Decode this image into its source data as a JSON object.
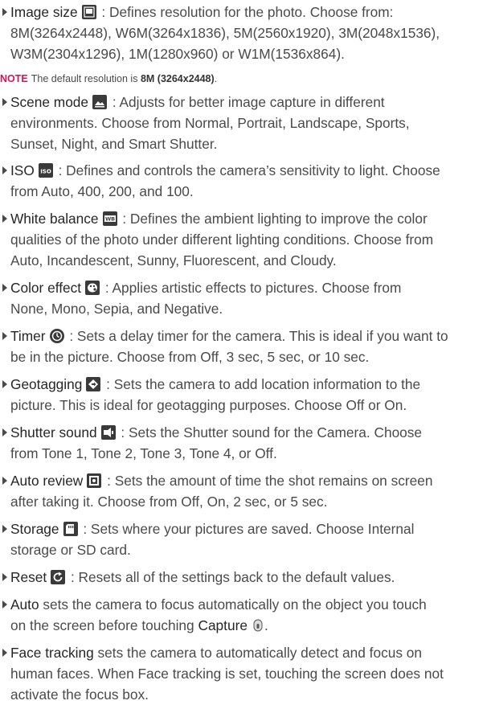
{
  "items": [
    {
      "term": "Image size",
      "icon": "image-size-icon",
      "lines": [
        " : Defines resolution for the photo.  Choose from:",
        "8M(3264x2448), W6M(3264x1836), 5M(2560x1920), 3M(2048x1536),",
        "W3M(2304x1296), 1M(1280x960) or W1M(1536x864)."
      ]
    },
    {
      "term": "Scene mode",
      "icon": "scene-mode-icon",
      "lines": [
        " : Adjusts for better image capture in different",
        "environments. Choose from Normal, Portrait, Landscape, Sports,",
        "Sunset, Night, and Smart Shutter."
      ]
    },
    {
      "term": "ISO",
      "icon": "iso-icon",
      "lines": [
        " : Defines and controls the camera’s sensitivity to light. Choose",
        "from Auto, 400, 200, and 100."
      ]
    },
    {
      "term": "White balance",
      "icon": "white-balance-icon",
      "lines": [
        " : Defines the ambient lighting to improve the color",
        "qualities of the photo under different lighting conditions. Choose from",
        "Auto, Incandescent, Sunny, Fluorescent, and Cloudy."
      ]
    },
    {
      "term": "Color effect",
      "icon": "color-effect-icon",
      "lines": [
        " : Applies artistic effects to pictures. Choose from",
        "None, Mono, Sepia, and Negative."
      ]
    },
    {
      "term": "Timer",
      "icon": "timer-icon",
      "lines": [
        " : Sets a delay timer for the camera. This is ideal if you want to",
        "be in the picture. Choose from Off, 3 sec, 5 sec, or 10 sec."
      ]
    },
    {
      "term": "Geotagging",
      "icon": "geotagging-icon",
      "lines": [
        " : Sets the camera to add location information to the",
        "picture. This is ideal for geotagging purposes. Choose Off or On."
      ]
    },
    {
      "term": "Shutter sound",
      "icon": "shutter-sound-icon",
      "lines": [
        " : Sets the Shutter sound for the Camera. Choose",
        "from Tone 1, Tone 2, Tone 3, Tone 4, or Off."
      ]
    },
    {
      "term": "Auto review",
      "icon": "auto-review-icon",
      "lines": [
        " : Sets the amount of time the shot remains on screen",
        "after taking it. Choose from Off, On, 2 sec, or  5 sec."
      ]
    },
    {
      "term": "Storage",
      "icon": "storage-icon",
      "lines": [
        " : Sets where your pictures are saved. Choose Internal",
        "storage or SD card."
      ]
    },
    {
      "term": "Reset",
      "icon": "reset-icon",
      "lines": [
        " : Resets all of the settings back to the default values."
      ]
    },
    {
      "term": "Auto",
      "lines": [
        " sets the camera to focus automatically on the object you touch",
        "on the screen before touching "
      ],
      "capture": "Capture",
      "end": "."
    },
    {
      "term": "Face tracking",
      "lines": [
        " sets the camera to automatically detect and focus on",
        "human faces. When Face tracking is set, touching the screen does not",
        "activate the focus box."
      ]
    }
  ],
  "note": {
    "label": "NOTE",
    "text": "The default resolution is ",
    "value": "8M (3264x2448)",
    "end": "."
  },
  "colors": {
    "text": "#4a4a4a",
    "note": "#d4145a",
    "icon": "#2e2e2e"
  }
}
